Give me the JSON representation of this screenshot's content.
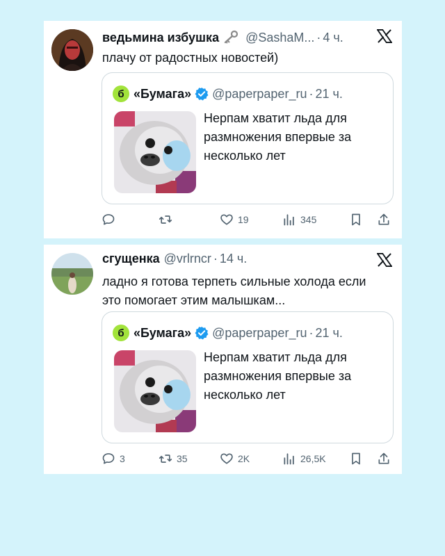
{
  "tweets": [
    {
      "author": {
        "name": "ведьмина избушка",
        "emoji": "key-emoji",
        "handle": "@SashaM...",
        "time": "4 ч."
      },
      "text": "плачу от радостных новостей)",
      "quote": {
        "logo_letter": "б",
        "name": "«Бумага»",
        "handle": "@paperpaper_ru",
        "time": "21 ч.",
        "text": "Нерпам хватит льда для размножения впервые за несколько лет"
      },
      "actions": {
        "reply": "",
        "retweet": "",
        "like": "19",
        "views": "345"
      }
    },
    {
      "author": {
        "name": "сгущенка",
        "handle": "@vrlrncr",
        "time": "14 ч."
      },
      "text": "ладно я готова терпеть сильные холода если это помогает этим малышкам...",
      "quote": {
        "logo_letter": "б",
        "name": "«Бумага»",
        "handle": "@paperpaper_ru",
        "time": "21 ч.",
        "text": "Нерпам хватит льда для размножения впервые за несколько лет"
      },
      "actions": {
        "reply": "3",
        "retweet": "35",
        "like": "2K",
        "views": "26,5K"
      }
    }
  ],
  "dot": "·",
  "icons": {
    "platform": "x-logo-icon",
    "verified": "verified-badge-icon",
    "reply": "reply-icon",
    "retweet": "retweet-icon",
    "like": "heart-icon",
    "views": "views-icon",
    "bookmark": "bookmark-icon",
    "share": "share-icon"
  },
  "colors": {
    "background": "#d4f3fb",
    "card": "#ffffff",
    "secondary_text": "#536471",
    "border": "#cfd9de",
    "verified_blue": "#1d9bf0",
    "bumaga_green": "#a2e33b"
  }
}
